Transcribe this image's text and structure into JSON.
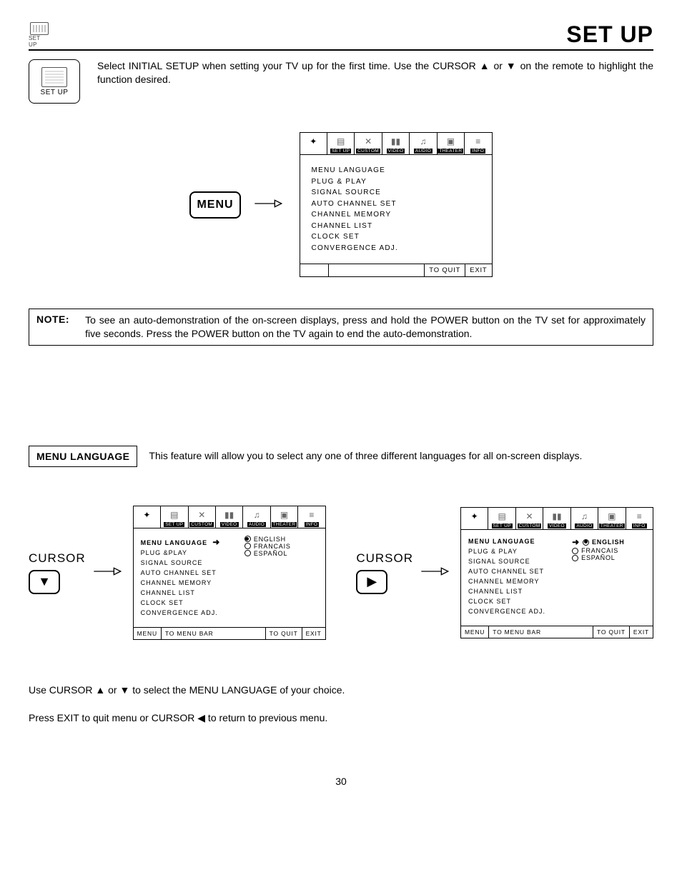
{
  "header": {
    "mini_caption": "SET UP",
    "title": "SET UP"
  },
  "intro": {
    "remote_label": "SET UP",
    "before": "Select INITIAL SETUP when setting your TV up for the first time.  Use the CURSOR ",
    "links": {
      "up": "▲",
      "or": " or ",
      "down": "▼"
    },
    "after": " on the remote to highlight the function desired."
  },
  "osd_tabs": [
    "",
    "SET UP",
    "CUSTOM",
    "VIDEO",
    "AUDIO",
    "THEATER",
    "INFO"
  ],
  "setup_items": [
    "MENU LANGUAGE",
    "PLUG & PLAY",
    "SIGNAL SOURCE",
    "AUTO CHANNEL SET",
    "CHANNEL MEMORY",
    "CHANNEL LIST",
    "CLOCK SET",
    "CONVERGENCE ADJ."
  ],
  "footer1": {
    "quit": "TO QUIT",
    "exit": "EXIT"
  },
  "menu_btn": "MENU",
  "note": {
    "label": "NOTE:",
    "body": "To see an auto-demonstration of the on-screen displays, press and hold the POWER button on the TV set for approximately five seconds. Press the POWER button on the TV again to end the auto-demonstration."
  },
  "feature": {
    "heading": "MENU LANGUAGE",
    "desc": "This feature will allow you to select any one of three different languages for all on-screen displays."
  },
  "flow": {
    "cursor_label": "CURSOR",
    "key_down": "▼",
    "key_right": "▶",
    "langs": [
      "ENGLISH",
      "FRANCAIS",
      "ESPAÑOL"
    ],
    "items_left": [
      "MENU LANGUAGE",
      "PLUG &PLAY",
      "SIGNAL SOURCE",
      "AUTO CHANNEL SET",
      "CHANNEL MEMORY",
      "CHANNEL LIST",
      "CLOCK SET",
      "CONVERGENCE ADJ."
    ],
    "items_right": [
      "MENU LANGUAGE",
      "PLUG & PLAY",
      "SIGNAL SOURCE",
      "AUTO CHANNEL SET",
      "CHANNEL MEMORY",
      "CHANNEL LIST",
      "CLOCK SET",
      "CONVERGENCE ADJ."
    ],
    "footer": {
      "menu": "MENU",
      "bar": "TO MENU BAR",
      "quit": "TO QUIT",
      "exit": "EXIT"
    }
  },
  "closing": {
    "p1a": "Use CURSOR ",
    "p1b": " or ",
    "p1c": " to select the MENU LANGUAGE of your choice.",
    "p2a": "Press EXIT to quit menu or CURSOR ",
    "p2b": " to return to previous menu.",
    "up": "▲",
    "down": "▼",
    "left": "◀"
  },
  "page": "30"
}
